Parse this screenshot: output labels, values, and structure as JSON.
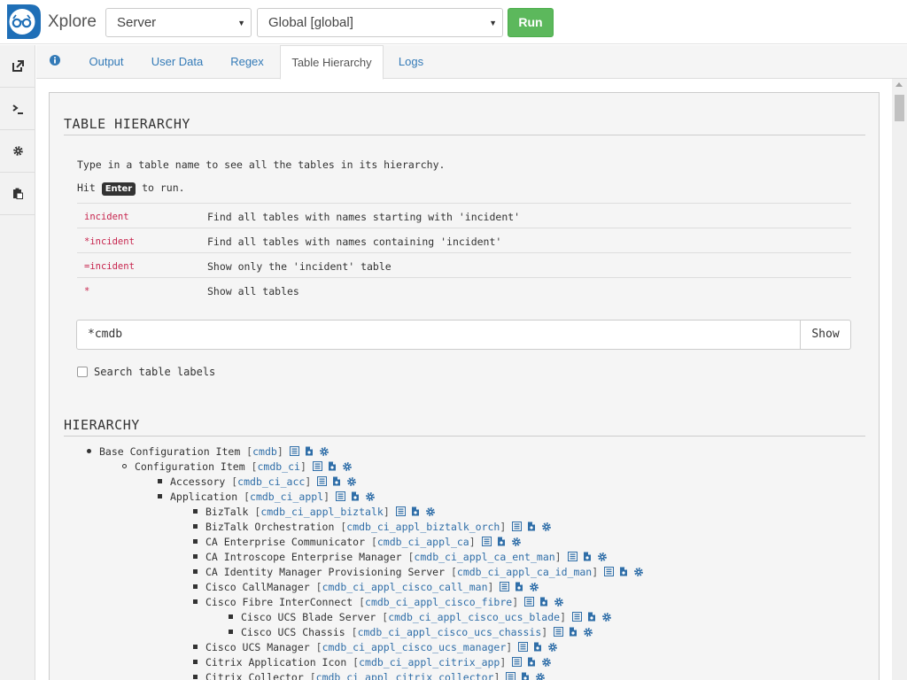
{
  "app": {
    "title": "Xplore"
  },
  "header": {
    "server_select": "Server",
    "scope_select": "Global [global]",
    "run_label": "Run"
  },
  "tabs": [
    {
      "label": "Output"
    },
    {
      "label": "User Data"
    },
    {
      "label": "Regex"
    },
    {
      "label": "Table Hierarchy"
    },
    {
      "label": "Logs"
    }
  ],
  "table_hierarchy": {
    "title": "TABLE HIERARCHY",
    "intro": "Type in a table name to see all the tables in its hierarchy.",
    "hit": "Hit",
    "key": "Enter",
    "to_run": "to run.",
    "examples": [
      {
        "code": "incident",
        "desc": "Find all tables with names starting with 'incident'"
      },
      {
        "code": "*incident",
        "desc": "Find all tables with names containing 'incident'"
      },
      {
        "code": "=incident",
        "desc": "Show only the 'incident' table"
      },
      {
        "code": "*",
        "desc": "Show all tables"
      }
    ],
    "search_value": "*cmdb",
    "show_label": "Show",
    "search_labels": "Search table labels"
  },
  "hierarchy": {
    "title": "HIERARCHY",
    "items": [
      {
        "label": "Base Configuration Item",
        "name": "cmdb",
        "level": 1
      },
      {
        "label": "Configuration Item",
        "name": "cmdb_ci",
        "level": 2
      },
      {
        "label": "Accessory",
        "name": "cmdb_ci_acc",
        "level": 3
      },
      {
        "label": "Application",
        "name": "cmdb_ci_appl",
        "level": 3
      },
      {
        "label": "BizTalk",
        "name": "cmdb_ci_appl_biztalk",
        "level": 4
      },
      {
        "label": "BizTalk Orchestration",
        "name": "cmdb_ci_appl_biztalk_orch",
        "level": 4
      },
      {
        "label": "CA Enterprise Communicator",
        "name": "cmdb_ci_appl_ca",
        "level": 4
      },
      {
        "label": "CA Introscope Enterprise Manager",
        "name": "cmdb_ci_appl_ca_ent_man",
        "level": 4
      },
      {
        "label": "CA Identity Manager Provisioning Server",
        "name": "cmdb_ci_appl_ca_id_man",
        "level": 4
      },
      {
        "label": "Cisco CallManager",
        "name": "cmdb_ci_appl_cisco_call_man",
        "level": 4
      },
      {
        "label": "Cisco Fibre InterConnect",
        "name": "cmdb_ci_appl_cisco_fibre",
        "level": 4
      },
      {
        "label": "Cisco UCS Blade Server",
        "name": "cmdb_ci_appl_cisco_ucs_blade",
        "level": 5
      },
      {
        "label": "Cisco UCS Chassis",
        "name": "cmdb_ci_appl_cisco_ucs_chassis",
        "level": 5
      },
      {
        "label": "Cisco UCS Manager",
        "name": "cmdb_ci_appl_cisco_ucs_manager",
        "level": 4
      },
      {
        "label": "Citrix Application Icon",
        "name": "cmdb_ci_appl_citrix_app",
        "level": 4
      },
      {
        "label": "Citrix Collector",
        "name": "cmdb_ci_appl_citrix_collector",
        "level": 4
      }
    ]
  },
  "colors": {
    "accent": "#337ab7",
    "run_button": "#5cb85c",
    "code": "#c7254e",
    "icon": "#2f6ea8"
  }
}
